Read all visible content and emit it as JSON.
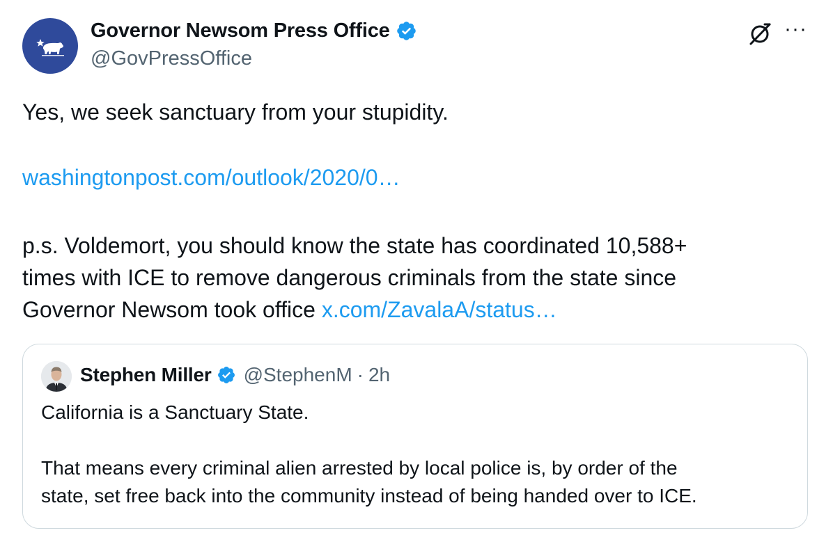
{
  "author": {
    "name": "Governor Newsom Press Office",
    "handle": "@GovPressOffice",
    "avatar_icon": "california-bear-icon",
    "verified": true
  },
  "actions": {
    "grok_icon": "grok-icon",
    "more_label": "···"
  },
  "tweet": {
    "line1": "Yes, we seek sanctuary from your stupidity.",
    "link1": "washingtonpost.com/outlook/2020/0…",
    "ps_line1": "p.s. Voldemort, you should know the state has coordinated 10,588+",
    "ps_line2": "times with ICE to remove dangerous criminals from the state since",
    "ps_line3": "Governor Newsom took office ",
    "link2": "x.com/ZavalaA/status…"
  },
  "quoted": {
    "name": "Stephen Miller",
    "handle": "@StephenM",
    "separator": "·",
    "time": "2h",
    "verified": true,
    "line1": "California is a Sanctuary State.",
    "line2": "That means every criminal alien arrested by local police is, by order of the",
    "line3": "state, set free back into the community instead of being handed over to ICE."
  },
  "colors": {
    "link": "#1d9bf0",
    "verified": "#1d9bf0",
    "secondary_text": "#536471",
    "avatar_bg": "#2f4a9b",
    "border": "#cfd9de"
  }
}
